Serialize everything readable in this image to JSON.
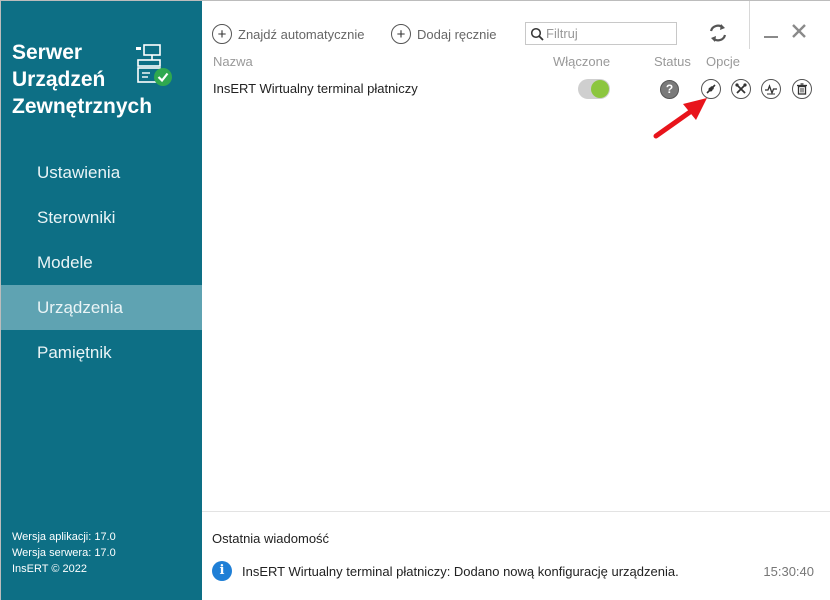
{
  "app": {
    "title_lines": [
      "Serwer",
      "Urządzeń",
      "Zewnętrznych"
    ],
    "logo_icon": "server-device-check-icon"
  },
  "sidebar": {
    "items": [
      {
        "label": "Ustawienia",
        "active": false
      },
      {
        "label": "Sterowniki",
        "active": false
      },
      {
        "label": "Modele",
        "active": false
      },
      {
        "label": "Urządzenia",
        "active": true
      },
      {
        "label": "Pamiętnik",
        "active": false
      }
    ],
    "version": {
      "app": "Wersja aplikacji: 17.0",
      "server": "Wersja serwera: 17.0",
      "copyright": "InsERT © 2022"
    }
  },
  "toolbar": {
    "find_auto_label": "Znajdź automatycznie",
    "add_manual_label": "Dodaj ręcznie",
    "filter_placeholder": "Filtruj",
    "filter_value": ""
  },
  "table": {
    "columns": {
      "name": "Nazwa",
      "enabled": "Włączone",
      "status": "Status",
      "options": "Opcje"
    },
    "rows": [
      {
        "name": "InsERT Wirtualny terminal płatniczy",
        "enabled": true,
        "status_symbol": "?",
        "options_icons": [
          "connect-icon",
          "tools-icon",
          "diagnostics-icon",
          "delete-icon"
        ]
      }
    ]
  },
  "footer": {
    "title": "Ostatnia wiadomość",
    "message": "InsERT Wirtualny terminal płatniczy: Dodano nową konfigurację urządzenia.",
    "time": "15:30:40"
  },
  "colors": {
    "sidebar_bg": "#0d6f85",
    "sidebar_active": "#5fa3b2",
    "toggle_on": "#8cc63f",
    "info_blue": "#1f7fd6",
    "annotation_arrow": "#e8141b"
  }
}
